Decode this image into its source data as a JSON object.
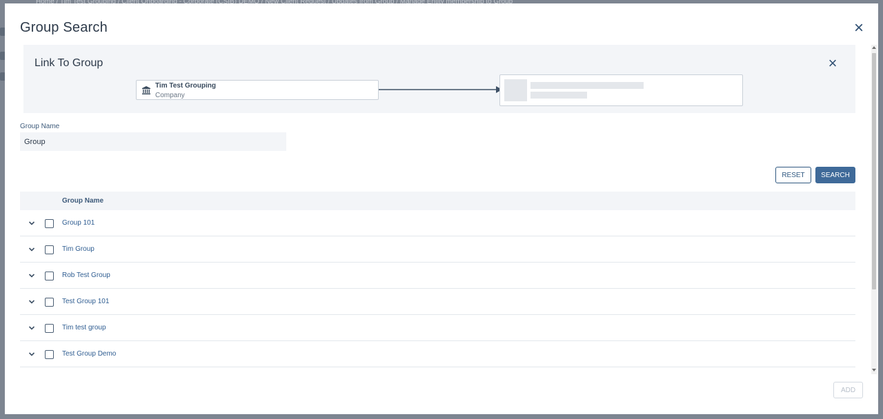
{
  "background": {
    "breadcrumb": "Home / Tim Test Grouping / Client Onboarding - Corporate (CSIB) DEMO / New Client Request / Updates from Group / Manage Entity membership to Group"
  },
  "modal": {
    "title": "Group Search",
    "close_icon": "close-icon"
  },
  "link_panel": {
    "title": "Link To Group",
    "close_icon": "close-icon",
    "entity": {
      "name": "Tim Test Grouping",
      "type": "Company",
      "icon": "bank-building-icon"
    }
  },
  "form": {
    "group_name_label": "Group Name",
    "group_name_value": "Group"
  },
  "actions": {
    "reset_label": "RESET",
    "search_label": "SEARCH",
    "add_label": "ADD"
  },
  "table": {
    "header": "Group Name",
    "rows": [
      "Group 101",
      "Tim Group",
      "Rob Test Group",
      "Test Group 101",
      "Tim test group",
      "Test Group Demo"
    ]
  },
  "colors": {
    "accent": "#3f6a99",
    "link": "#2f5d91",
    "panel_bg": "#f3f5f8"
  }
}
